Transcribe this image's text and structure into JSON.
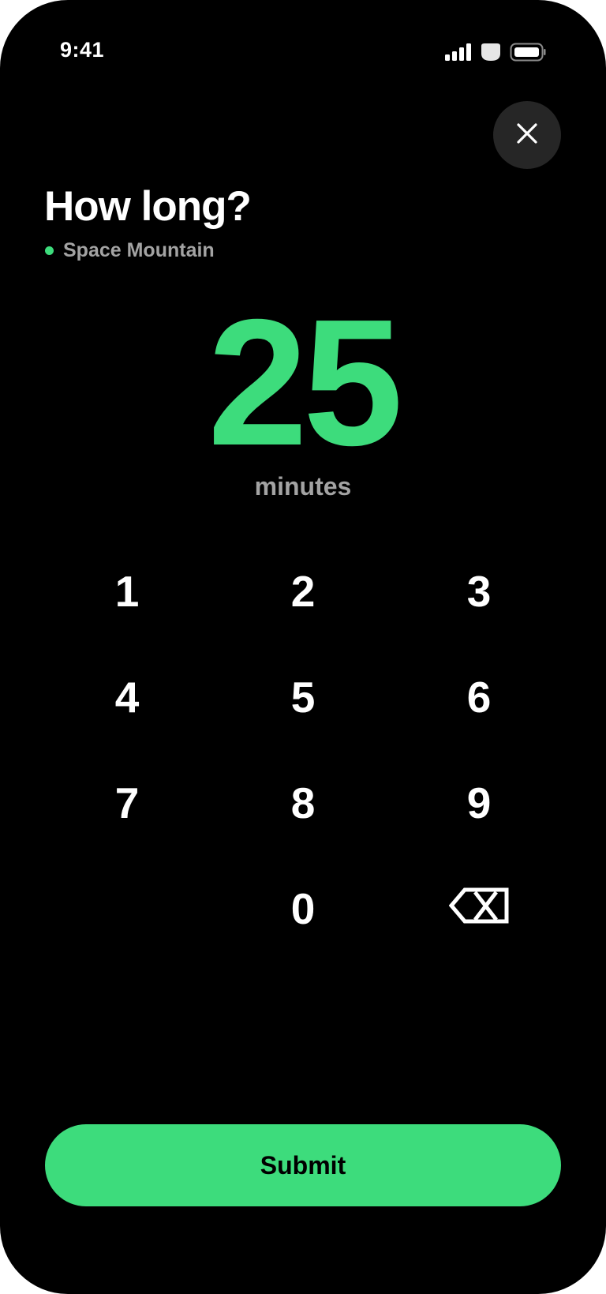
{
  "status_bar": {
    "time": "9:41",
    "icons": [
      "signal-icon",
      "wifi-icon",
      "battery-icon"
    ]
  },
  "header": {
    "close_icon": "close-icon",
    "title": "How long?",
    "attraction_name": "Space Mountain"
  },
  "wait_time": {
    "value": "25",
    "unit": "minutes"
  },
  "keypad": {
    "keys": [
      "1",
      "2",
      "3",
      "4",
      "5",
      "6",
      "7",
      "8",
      "9",
      "0"
    ],
    "backspace_icon": "backspace-icon"
  },
  "submit": {
    "label": "Submit"
  },
  "colors": {
    "accent": "#3ddc7c",
    "background": "#000000",
    "muted_text": "#a3a3a3",
    "close_button_bg": "#262626"
  }
}
